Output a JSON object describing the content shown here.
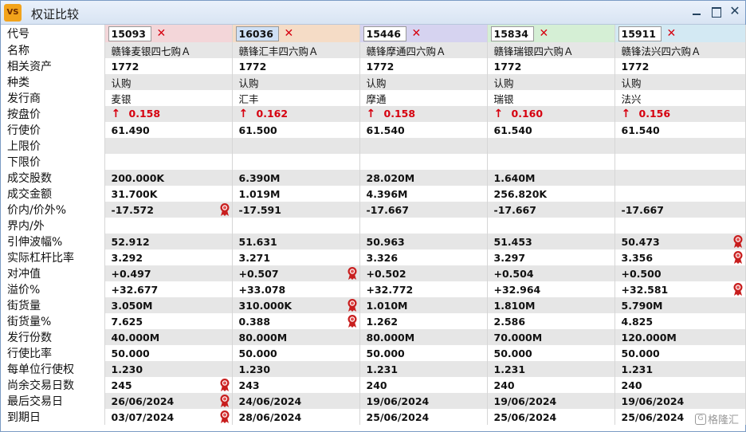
{
  "window": {
    "app_logo": "VS",
    "title": "权证比较"
  },
  "rows": {
    "code_label": "代号",
    "name_label": "名称",
    "asset_label": "相关资产",
    "type_label": "种类",
    "issuer_label": "发行商",
    "bid_label": "按盘价",
    "strike_label": "行使价",
    "upper_label": "上限价",
    "lower_label": "下限价",
    "vol_label": "成交股数",
    "turnover_label": "成交金额",
    "moneyness_label": "价内/价外%",
    "inout_label": "界内/外",
    "iv_label": "引伸波幅%",
    "gearing_label": "实际杠杆比率",
    "delta_label": "对冲值",
    "premium_label": "溢价%",
    "outstanding_label": "街货量",
    "outstanding_pct_label": "街货量%",
    "issued_label": "发行份数",
    "ratio_label": "行使比率",
    "per_unit_label": "每单位行使权",
    "days_label": "尚余交易日数",
    "last_trade_label": "最后交易日",
    "expiry_label": "到期日"
  },
  "warrants": [
    {
      "code": "15093",
      "name": "赣锋麦银四七购Ａ",
      "asset": "1772",
      "type": "认购",
      "issuer": "麦银",
      "bid": "0.158",
      "strike": "61.490",
      "upper": "",
      "lower": "",
      "volume": "200.000K",
      "turnover": "31.700K",
      "moneyness": "-17.572",
      "inout": "",
      "iv": "52.912",
      "gearing": "3.292",
      "delta": "+0.497",
      "premium": "+32.677",
      "outstanding": "3.050M",
      "outstanding_pct": "7.625",
      "issued": "40.000M",
      "ratio": "50.000",
      "per_unit": "1.230",
      "days": "245",
      "last_trade": "26/06/2024",
      "expiry": "03/07/2024"
    },
    {
      "code": "16036",
      "name": "赣锋汇丰四六购Ａ",
      "asset": "1772",
      "type": "认购",
      "issuer": "汇丰",
      "bid": "0.162",
      "strike": "61.500",
      "upper": "",
      "lower": "",
      "volume": "6.390M",
      "turnover": "1.019M",
      "moneyness": "-17.591",
      "inout": "",
      "iv": "51.631",
      "gearing": "3.271",
      "delta": "+0.507",
      "premium": "+33.078",
      "outstanding": "310.000K",
      "outstanding_pct": "0.388",
      "issued": "80.000M",
      "ratio": "50.000",
      "per_unit": "1.230",
      "days": "243",
      "last_trade": "24/06/2024",
      "expiry": "28/06/2024"
    },
    {
      "code": "15446",
      "name": "赣锋摩通四六购Ａ",
      "asset": "1772",
      "type": "认购",
      "issuer": "摩通",
      "bid": "0.158",
      "strike": "61.540",
      "upper": "",
      "lower": "",
      "volume": "28.020M",
      "turnover": "4.396M",
      "moneyness": "-17.667",
      "inout": "",
      "iv": "50.963",
      "gearing": "3.326",
      "delta": "+0.502",
      "premium": "+32.772",
      "outstanding": "1.010M",
      "outstanding_pct": "1.262",
      "issued": "80.000M",
      "ratio": "50.000",
      "per_unit": "1.231",
      "days": "240",
      "last_trade": "19/06/2024",
      "expiry": "25/06/2024"
    },
    {
      "code": "15834",
      "name": "赣锋瑞银四六购Ａ",
      "asset": "1772",
      "type": "认购",
      "issuer": "瑞银",
      "bid": "0.160",
      "strike": "61.540",
      "upper": "",
      "lower": "",
      "volume": "1.640M",
      "turnover": "256.820K",
      "moneyness": "-17.667",
      "inout": "",
      "iv": "51.453",
      "gearing": "3.297",
      "delta": "+0.504",
      "premium": "+32.964",
      "outstanding": "1.810M",
      "outstanding_pct": "2.586",
      "issued": "70.000M",
      "ratio": "50.000",
      "per_unit": "1.231",
      "days": "240",
      "last_trade": "19/06/2024",
      "expiry": "25/06/2024"
    },
    {
      "code": "15911",
      "name": "赣锋法兴四六购Ａ",
      "asset": "1772",
      "type": "认购",
      "issuer": "法兴",
      "bid": "0.156",
      "strike": "61.540",
      "upper": "",
      "lower": "",
      "volume": "",
      "turnover": "",
      "moneyness": "-17.667",
      "inout": "",
      "iv": "50.473",
      "gearing": "3.356",
      "delta": "+0.500",
      "premium": "+32.581",
      "outstanding": "5.790M",
      "outstanding_pct": "4.825",
      "issued": "120.000M",
      "ratio": "50.000",
      "per_unit": "1.231",
      "days": "240",
      "last_trade": "19/06/2024",
      "expiry": "25/06/2024"
    }
  ],
  "colors": {
    "header_bg": [
      "#f3d6d9",
      "#f5dcc6",
      "#d6d3f0",
      "#d5efd5",
      "#d3e9f3"
    ],
    "up": "#d6000f",
    "badge": "#c81e1e"
  },
  "best_badges": {
    "moneyness": [
      0
    ],
    "iv": [
      4
    ],
    "gearing": [
      4
    ],
    "delta": [
      1
    ],
    "premium": [
      4
    ],
    "outstanding": [
      1
    ],
    "outstanding_pct": [
      1
    ],
    "days": [
      0
    ],
    "last_trade": [
      0
    ],
    "expiry": [
      0
    ]
  },
  "watermark": {
    "icon": "G",
    "text": "格隆汇"
  }
}
